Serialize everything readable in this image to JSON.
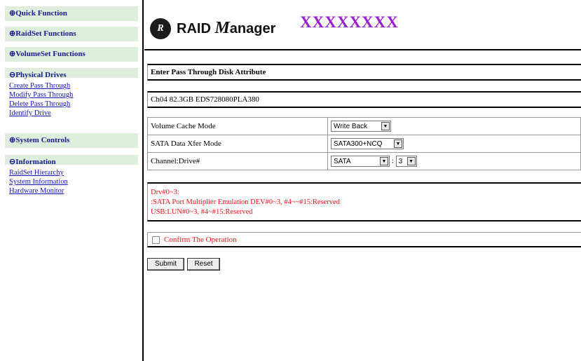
{
  "sidebar": {
    "quick_function": "⊕Quick Function",
    "raidset_functions": "⊕RaidSet Functions",
    "volumeset_functions": "⊕VolumeSet Functions",
    "physical_drives": "⊖Physical Drives",
    "physical_links": [
      "Create Pass Through",
      "Modify Pass Through",
      "Delete Pass Through",
      "Identify Drive"
    ],
    "system_controls": "⊕System Controls",
    "information": "⊖Information",
    "information_links": [
      "RaidSet Hierarchy",
      "System Information",
      "Hardware Monitor"
    ]
  },
  "header": {
    "logo_badge": "R",
    "logo_text_raid": "RAID ",
    "logo_text_m": "M",
    "logo_text_rest": "anager",
    "model": "XXXXXXXX"
  },
  "form": {
    "title": "Enter Pass Through Disk Attribute",
    "disk": "Ch04 82.3GB EDS728080PLA380",
    "rows": [
      {
        "label": "Volume Cache Mode",
        "value": "Write Back"
      },
      {
        "label": "SATA Data Xfer Mode",
        "value": "SATA300+NCQ"
      },
      {
        "label": "Channel:Drive#",
        "value": "SATA",
        "value2": "3",
        "separator": ":"
      }
    ],
    "notes": [
      "Drv#0~3:",
      ":SATA Port Multiplier Emulation DEV#0~3, #4~~#15:Reserved",
      "USB:LUN#0~3, #4~#15:Reserved"
    ],
    "confirm_label": "Confirm The Operation",
    "submit_label": "Submit",
    "reset_label": "Reset"
  },
  "colors": {
    "sidebar_header_bg": "#ddeedd",
    "sidebar_header_text": "#1a1a8c",
    "link": "#1515b5",
    "model_text": "#9a1ed0",
    "note_text": "#e8141a"
  }
}
